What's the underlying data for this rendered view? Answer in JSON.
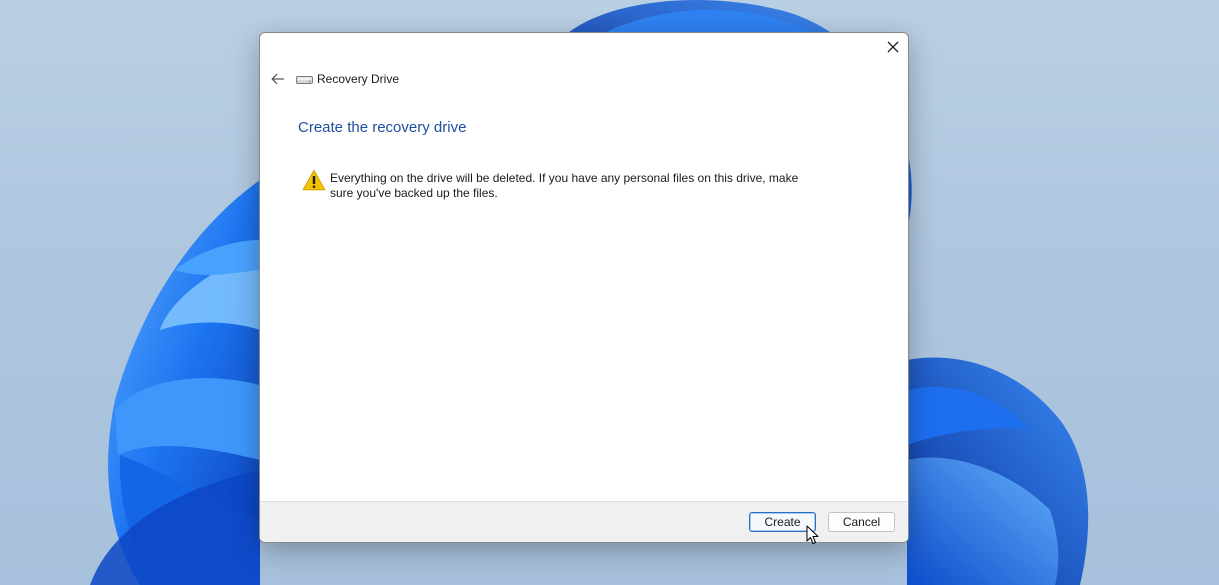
{
  "dialog": {
    "title": "Recovery Drive",
    "heading": "Create the recovery drive",
    "warning_line1": "Everything on the drive will be deleted. If you have any personal files on this drive, make",
    "warning_line2": "sure you've backed up the files.",
    "icons": [
      "back-arrow-icon",
      "drive-icon",
      "warning-icon",
      "close-icon"
    ]
  },
  "footer": {
    "create_label": "Create",
    "cancel_label": "Cancel"
  },
  "colors": {
    "heading": "#1f4e9e",
    "primary_button_border": "#2f6fbf",
    "warning_yellow": "#f2c300",
    "wallpaper_bloom": "#1565e0"
  }
}
